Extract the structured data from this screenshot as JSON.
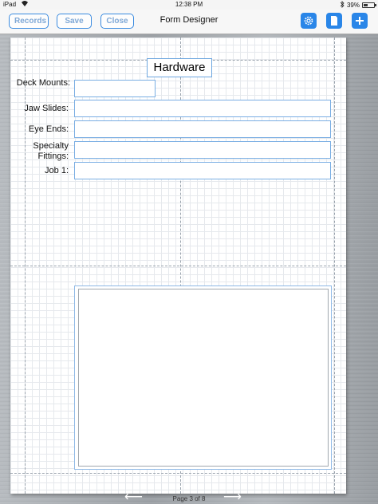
{
  "status_bar": {
    "device": "iPad",
    "time": "12:38 PM",
    "battery": "39%",
    "battery_level": 0.39
  },
  "nav": {
    "title": "Form Designer",
    "buttons": {
      "records": "Records",
      "save": "Save",
      "close": "Close"
    },
    "icons": [
      "gear-icon",
      "page-icon",
      "plus-icon"
    ]
  },
  "form": {
    "title": "Hardware",
    "fields": [
      {
        "label": "Deck Mounts:",
        "value": ""
      },
      {
        "label": "Jaw Slides:",
        "value": ""
      },
      {
        "label": "Eye Ends:",
        "value": ""
      },
      {
        "label": "Specialty Fittings:",
        "value": ""
      },
      {
        "label": "Job 1:",
        "value": ""
      }
    ]
  },
  "footer": {
    "page_label": "Page 3 of 8",
    "prev_icon": "left-arrow-icon",
    "next_icon": "right-arrow-icon"
  }
}
